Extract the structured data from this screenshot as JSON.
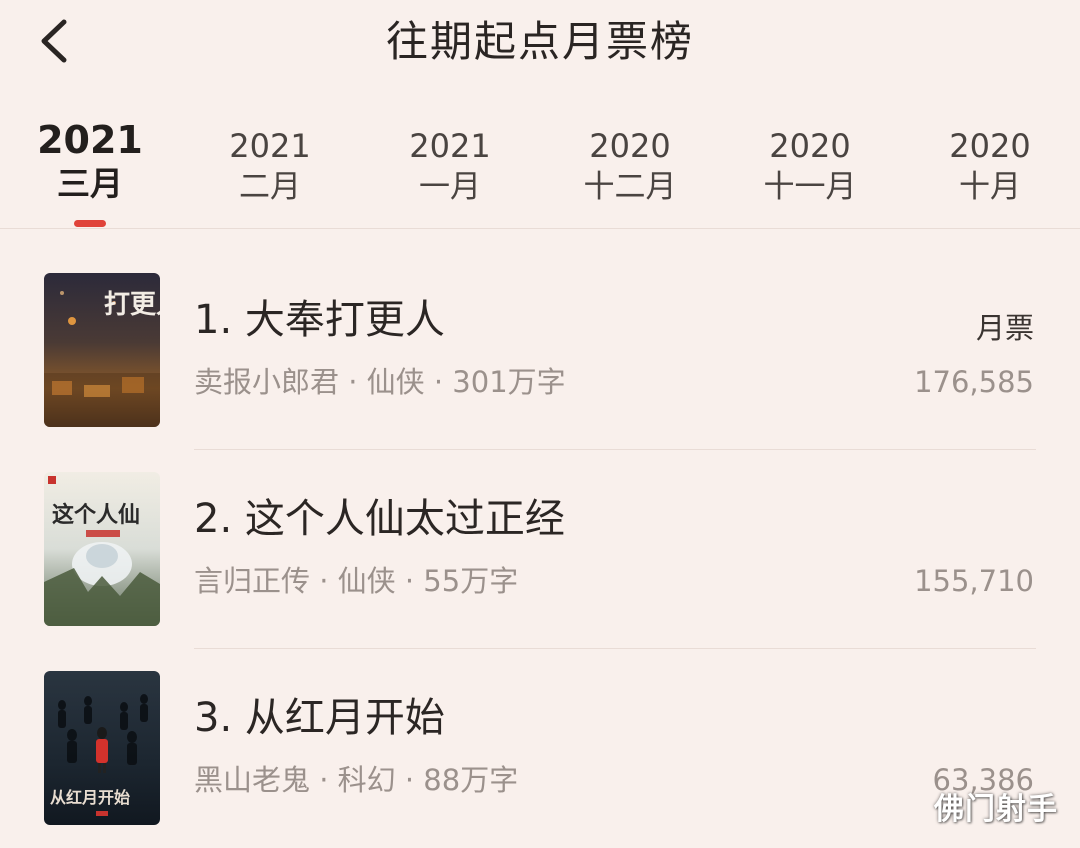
{
  "header": {
    "title": "往期起点月票榜",
    "back_icon": "chevron-left-icon"
  },
  "tabs": [
    {
      "year": "2021",
      "month": "三月",
      "active": true
    },
    {
      "year": "2021",
      "month": "二月",
      "active": false
    },
    {
      "year": "2021",
      "month": "一月",
      "active": false
    },
    {
      "year": "2020",
      "month": "十二月",
      "active": false
    },
    {
      "year": "2020",
      "month": "十一月",
      "active": false
    },
    {
      "year": "2020",
      "month": "十月",
      "active": false
    }
  ],
  "colors": {
    "background": "#f9f0ec",
    "accent": "#e0433a",
    "text_primary": "#2b2624",
    "text_secondary": "#9b918c"
  },
  "metric_label": "月票",
  "books": [
    {
      "title": "1. 大奉打更人",
      "author": "卖报小郎君",
      "genre": "仙侠",
      "words": "301万字",
      "meta": "卖报小郎君 · 仙侠 · 301万字",
      "votes": "176,585",
      "cover_text": "打更人"
    },
    {
      "title": "2. 这个人仙太过正经",
      "author": "言归正传",
      "genre": "仙侠",
      "words": "55万字",
      "meta": "言归正传 · 仙侠 · 55万字",
      "votes": "155,710",
      "cover_text": "这个人仙"
    },
    {
      "title": "3. 从红月开始",
      "author": "黑山老鬼",
      "genre": "科幻",
      "words": "88万字",
      "meta": "黑山老鬼 · 科幻 · 88万字",
      "votes": "63,386",
      "cover_text": "从红月开始"
    }
  ],
  "watermark": "佛门射手"
}
